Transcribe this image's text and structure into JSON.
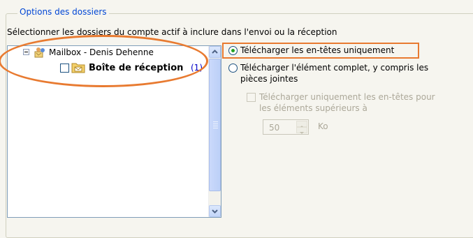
{
  "group": {
    "title": "Options des dossiers",
    "instruction": "Sélectionner les dossiers du compte actif à inclure dans l'envoi ou la réception"
  },
  "tree": {
    "mailbox": {
      "label": "Mailbox - Denis Dehenne",
      "expanded": true,
      "icon": "mailbox-icon"
    },
    "inbox": {
      "label": "Boîte de réception",
      "count": "(1)",
      "checked": false,
      "icon": "inbox-folder-icon"
    }
  },
  "download_options": {
    "option1": {
      "label": "Télécharger les en-têtes uniquement",
      "selected": true
    },
    "option2": {
      "label": "Télécharger l'élément complet, y compris les pièces jointes",
      "selected": false
    },
    "headers_for_large": {
      "label": "Télécharger uniquement les en-têtes pour les éléments supérieurs à",
      "checked": false,
      "enabled": false
    },
    "size_value": "50",
    "size_unit": "Ko"
  },
  "colors": {
    "annotation": "#e87a30",
    "group_title": "#0046d5",
    "count": "#0000c8",
    "selected_dot": "#21a121"
  }
}
